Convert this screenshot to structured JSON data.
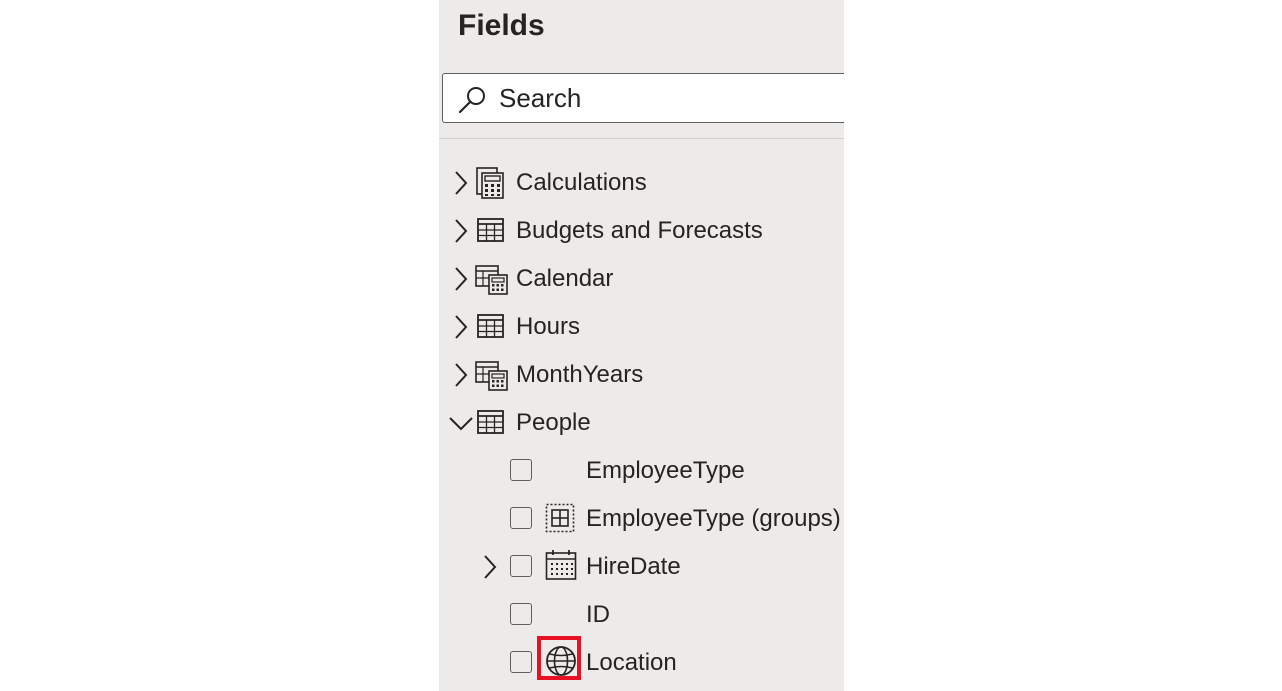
{
  "pane": {
    "title": "Fields"
  },
  "search": {
    "placeholder": "Search"
  },
  "tables": [
    {
      "name": "Calculations",
      "icon": "calculator-table-icon",
      "expanded": false
    },
    {
      "name": "Budgets and Forecasts",
      "icon": "table-icon",
      "expanded": false
    },
    {
      "name": "Calendar",
      "icon": "calculated-table-icon",
      "expanded": false
    },
    {
      "name": "Hours",
      "icon": "table-icon",
      "expanded": false
    },
    {
      "name": "MonthYears",
      "icon": "calculated-table-icon",
      "expanded": false
    },
    {
      "name": "People",
      "icon": "table-icon",
      "expanded": true
    }
  ],
  "people_fields": [
    {
      "name": "EmployeeType",
      "icon": "none",
      "checked": false,
      "expandable": false
    },
    {
      "name": "EmployeeType (groups)",
      "icon": "group-icon",
      "checked": false,
      "expandable": false
    },
    {
      "name": "HireDate",
      "icon": "calendar-icon",
      "checked": false,
      "expandable": true
    },
    {
      "name": "ID",
      "icon": "none",
      "checked": false,
      "expandable": false
    },
    {
      "name": "Location",
      "icon": "globe-icon",
      "checked": false,
      "expandable": false,
      "highlighted": true
    }
  ],
  "colors": {
    "pane_background": "#edebe9",
    "text": "#252423",
    "highlight": "#e81123"
  }
}
